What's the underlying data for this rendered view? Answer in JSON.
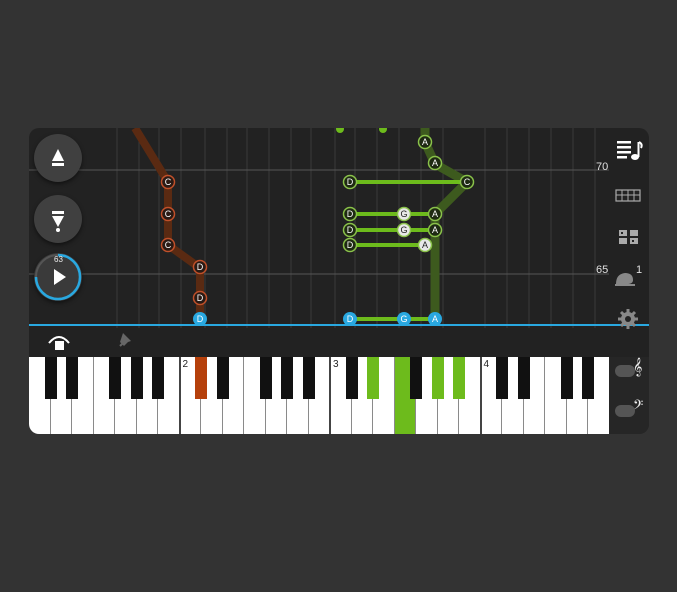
{
  "left_controls": {
    "speed_up": {
      "icon": "arrow-up-icon"
    },
    "speed_down": {
      "icon": "arrow-down-icon"
    },
    "play": {
      "icon": "play-icon",
      "progress_label": "63"
    }
  },
  "tempo_markers": {
    "upper": "70",
    "lower": "65"
  },
  "right_toolbar": {
    "icons": [
      "song-list-icon",
      "keyboard-layout-icon",
      "grid-view-icon",
      "snail-slow-icon",
      "settings-icon"
    ],
    "snail_value": "1"
  },
  "bottom_controls": {
    "left_icons": [
      "metronome-hand-icon",
      "pin-icon"
    ]
  },
  "note_labels": {
    "c": "C",
    "d": "D",
    "g": "G",
    "a": "A"
  },
  "keyboard": {
    "octave_labels": [
      "2",
      "3",
      "4"
    ],
    "highlight_colors": {
      "left_hand": "#b5400b",
      "right_hand": "#6dbb1c"
    }
  },
  "clef_toggles": {
    "treble": "𝄞",
    "bass": "𝄢"
  }
}
